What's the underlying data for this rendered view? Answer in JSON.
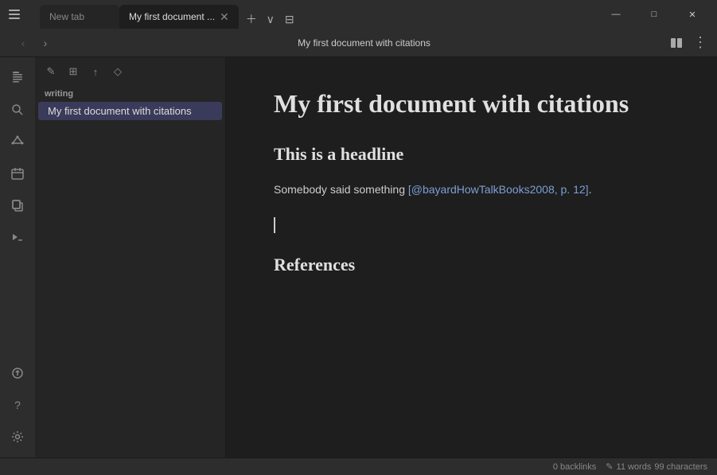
{
  "titlebar": {
    "tabs": [
      {
        "id": "new-tab",
        "label": "New tab",
        "active": false
      },
      {
        "id": "doc-tab",
        "label": "My first document ...",
        "active": true
      }
    ],
    "window_buttons": {
      "minimize": "—",
      "maximize": "□",
      "close": "✕"
    }
  },
  "toolbar": {
    "nav": {
      "back": "‹",
      "forward": "›"
    },
    "title": "My first document with citations",
    "actions": {
      "reader": "⊞",
      "more": "⋮"
    }
  },
  "activity_bar": {
    "items": [
      {
        "id": "files",
        "icon": "📁"
      },
      {
        "id": "search",
        "icon": "🔍"
      },
      {
        "id": "graph",
        "icon": "⬡"
      },
      {
        "id": "calendar",
        "icon": "📅"
      },
      {
        "id": "copy",
        "icon": "⧉"
      },
      {
        "id": "terminal",
        "icon": ">"
      }
    ],
    "bottom_items": [
      {
        "id": "publish",
        "icon": "⬆"
      },
      {
        "id": "help",
        "icon": "?"
      },
      {
        "id": "settings",
        "icon": "⚙"
      }
    ]
  },
  "sidebar": {
    "toolbar": {
      "buttons": [
        "✎",
        "⊞",
        "↑",
        "◇"
      ]
    },
    "section": {
      "label": "writing",
      "items": [
        {
          "id": "doc1",
          "label": "My first document with citations",
          "active": true
        }
      ]
    }
  },
  "document": {
    "title": "My first document with citations",
    "headline": "This is a headline",
    "body": "Somebody said something ",
    "citation": "[@bayardHowTalkBooks2008, p. 12]",
    "citation_end": ".",
    "references_heading": "References"
  },
  "statusbar": {
    "backlinks": "0 backlinks",
    "pencil_icon": "✎",
    "words": "11 words",
    "characters": "99 characters"
  }
}
